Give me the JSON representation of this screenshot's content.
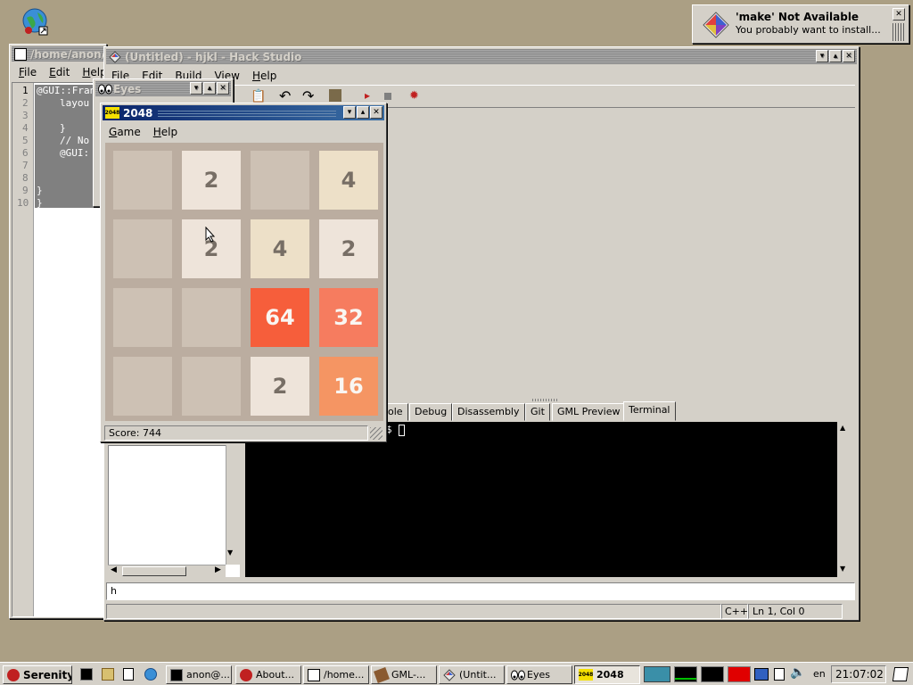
{
  "desktop": {
    "bg": "#ab9f84"
  },
  "notification": {
    "title": "'make' Not Available",
    "message": "You probably want to install..."
  },
  "terminal_window": {
    "title": "/home/anon/s",
    "menu": [
      "File",
      "Edit",
      "Help"
    ],
    "line_numbers": [
      "1",
      "2",
      "3",
      "4",
      "5",
      "6",
      "7",
      "8",
      "9",
      "10"
    ],
    "code_lines": [
      "@GUI::Fran",
      "layou",
      "",
      "}",
      "// No",
      "@GUI:",
      "",
      "",
      "}",
      "}"
    ]
  },
  "hack_studio": {
    "title": "(Untitled) - hjkl - Hack Studio",
    "menu": [
      "File",
      "Edit",
      "Build",
      "View",
      "Help"
    ],
    "tabs": [
      "ole",
      "Debug",
      "Disassembly",
      "Git",
      "GML Preview",
      "Terminal"
    ],
    "active_tab": "Terminal",
    "terminal_prompt": "$",
    "command_input": "h",
    "status_lang": "C++",
    "status_pos": "Ln 1, Col 0"
  },
  "eyes_window": {
    "title": "Eyes"
  },
  "game_window": {
    "title": "2048",
    "icon_text": "2048",
    "menu": [
      "Game",
      "Help"
    ],
    "score": "Score: 744"
  },
  "board": [
    [
      "",
      "2",
      "",
      "4"
    ],
    [
      "",
      "2",
      "4",
      "2"
    ],
    [
      "",
      "",
      "64",
      "32"
    ],
    [
      "",
      "",
      "2",
      "16"
    ]
  ],
  "tile_colors": {
    "2": {
      "bg": "#eee4da",
      "fg": "#776e65"
    },
    "4": {
      "bg": "#ede0c8",
      "fg": "#776e65"
    },
    "16": {
      "bg": "#f59563",
      "fg": "#f9f6f2"
    },
    "32": {
      "bg": "#f67c5f",
      "fg": "#f9f6f2"
    },
    "64": {
      "bg": "#f65e3b",
      "fg": "#f9f6f2"
    }
  },
  "taskbar": {
    "start_label": "Serenity",
    "tasks": [
      {
        "label": "anon@...",
        "icon": "terminal-icon"
      },
      {
        "label": "About...",
        "icon": "serenity-icon"
      },
      {
        "label": "/home...",
        "icon": "terminal-icon"
      },
      {
        "label": "GML-...",
        "icon": "gml-icon"
      },
      {
        "label": "(Untit...",
        "icon": "hack-studio-icon"
      },
      {
        "label": "Eyes",
        "icon": "eyes-icon"
      },
      {
        "label": "2048",
        "icon": "game-2048-icon"
      }
    ],
    "keymap": "en",
    "clock": "21:07:02"
  }
}
